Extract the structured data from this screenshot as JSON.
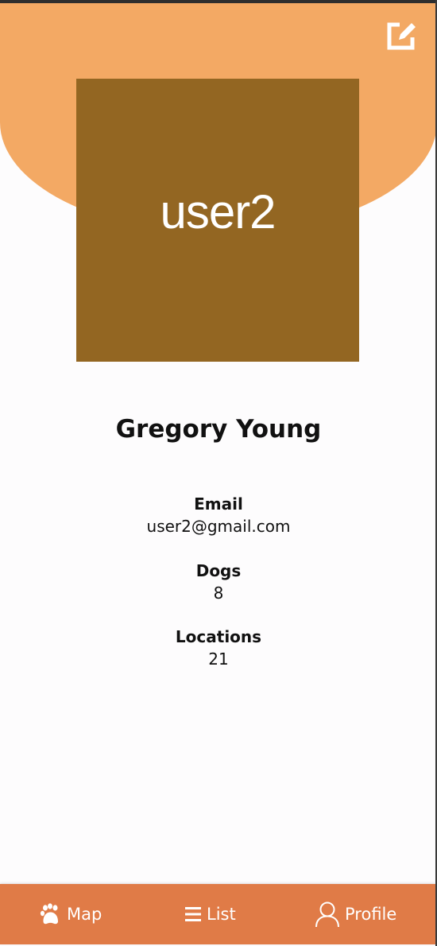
{
  "header": {
    "edit_icon": "edit-icon",
    "background_color": "#f3a964"
  },
  "profile": {
    "avatar_text": "user2",
    "avatar_color": "#936622",
    "name": "Gregory Young"
  },
  "details": {
    "email_label": "Email",
    "email_value": "user2@gmail.com",
    "dogs_label": "Dogs",
    "dogs_value": "8",
    "locations_label": "Locations",
    "locations_value": "21"
  },
  "nav": {
    "background_color": "#e07b47",
    "items": [
      {
        "label": "Map",
        "icon": "paw-icon"
      },
      {
        "label": "List",
        "icon": "list-icon"
      },
      {
        "label": "Profile",
        "icon": "person-icon"
      }
    ]
  }
}
